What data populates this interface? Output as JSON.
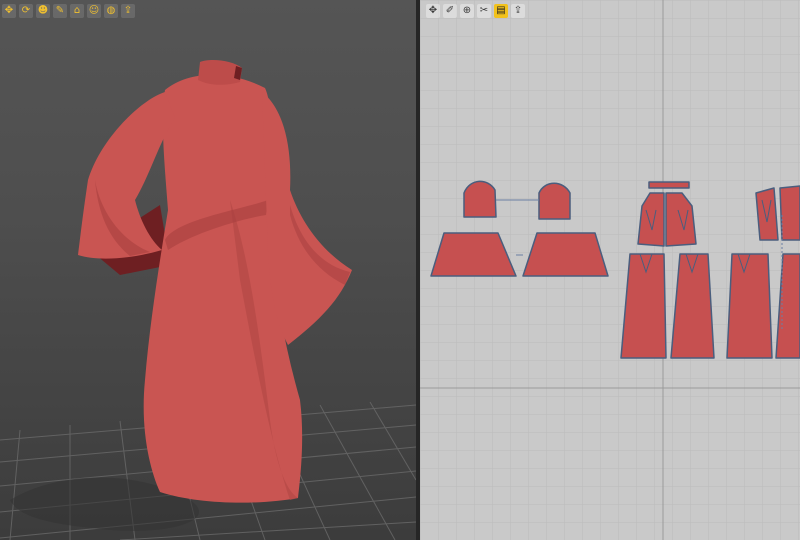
{
  "toolbar3d": {
    "tools": [
      {
        "icon": "select-move-icon",
        "glyph": "✥"
      },
      {
        "icon": "gizmo-icon",
        "glyph": "⟳"
      },
      {
        "icon": "avatar-icon",
        "glyph": "☻"
      },
      {
        "icon": "fold-icon",
        "glyph": "✎"
      },
      {
        "icon": "hanger-icon",
        "glyph": "⌂"
      },
      {
        "icon": "measure-icon",
        "glyph": "☺"
      },
      {
        "icon": "globe-texture-icon",
        "glyph": "◍"
      },
      {
        "icon": "export-icon",
        "glyph": "⇪"
      }
    ]
  },
  "toolbar2d": {
    "tools": [
      {
        "icon": "transform-pattern-icon",
        "glyph": "✥"
      },
      {
        "icon": "edit-pattern-icon",
        "glyph": "✐"
      },
      {
        "icon": "segment-icon",
        "glyph": "⊕"
      },
      {
        "icon": "seam-icon",
        "glyph": "✂"
      },
      {
        "icon": "internal-line-icon",
        "glyph": "▤",
        "active": true
      },
      {
        "icon": "notch-icon",
        "glyph": "⇪"
      }
    ]
  },
  "colors": {
    "fabric": "#c95552",
    "fabric_shade": "#a8403f",
    "fabric_dark": "#6e1f22",
    "pattern_fill": "#c65050",
    "pattern_outline": "#4a5e7e",
    "board_bg": "#c9c9c9",
    "grid_line": "#b8b8b8",
    "axis_line": "#9a9a9a"
  }
}
